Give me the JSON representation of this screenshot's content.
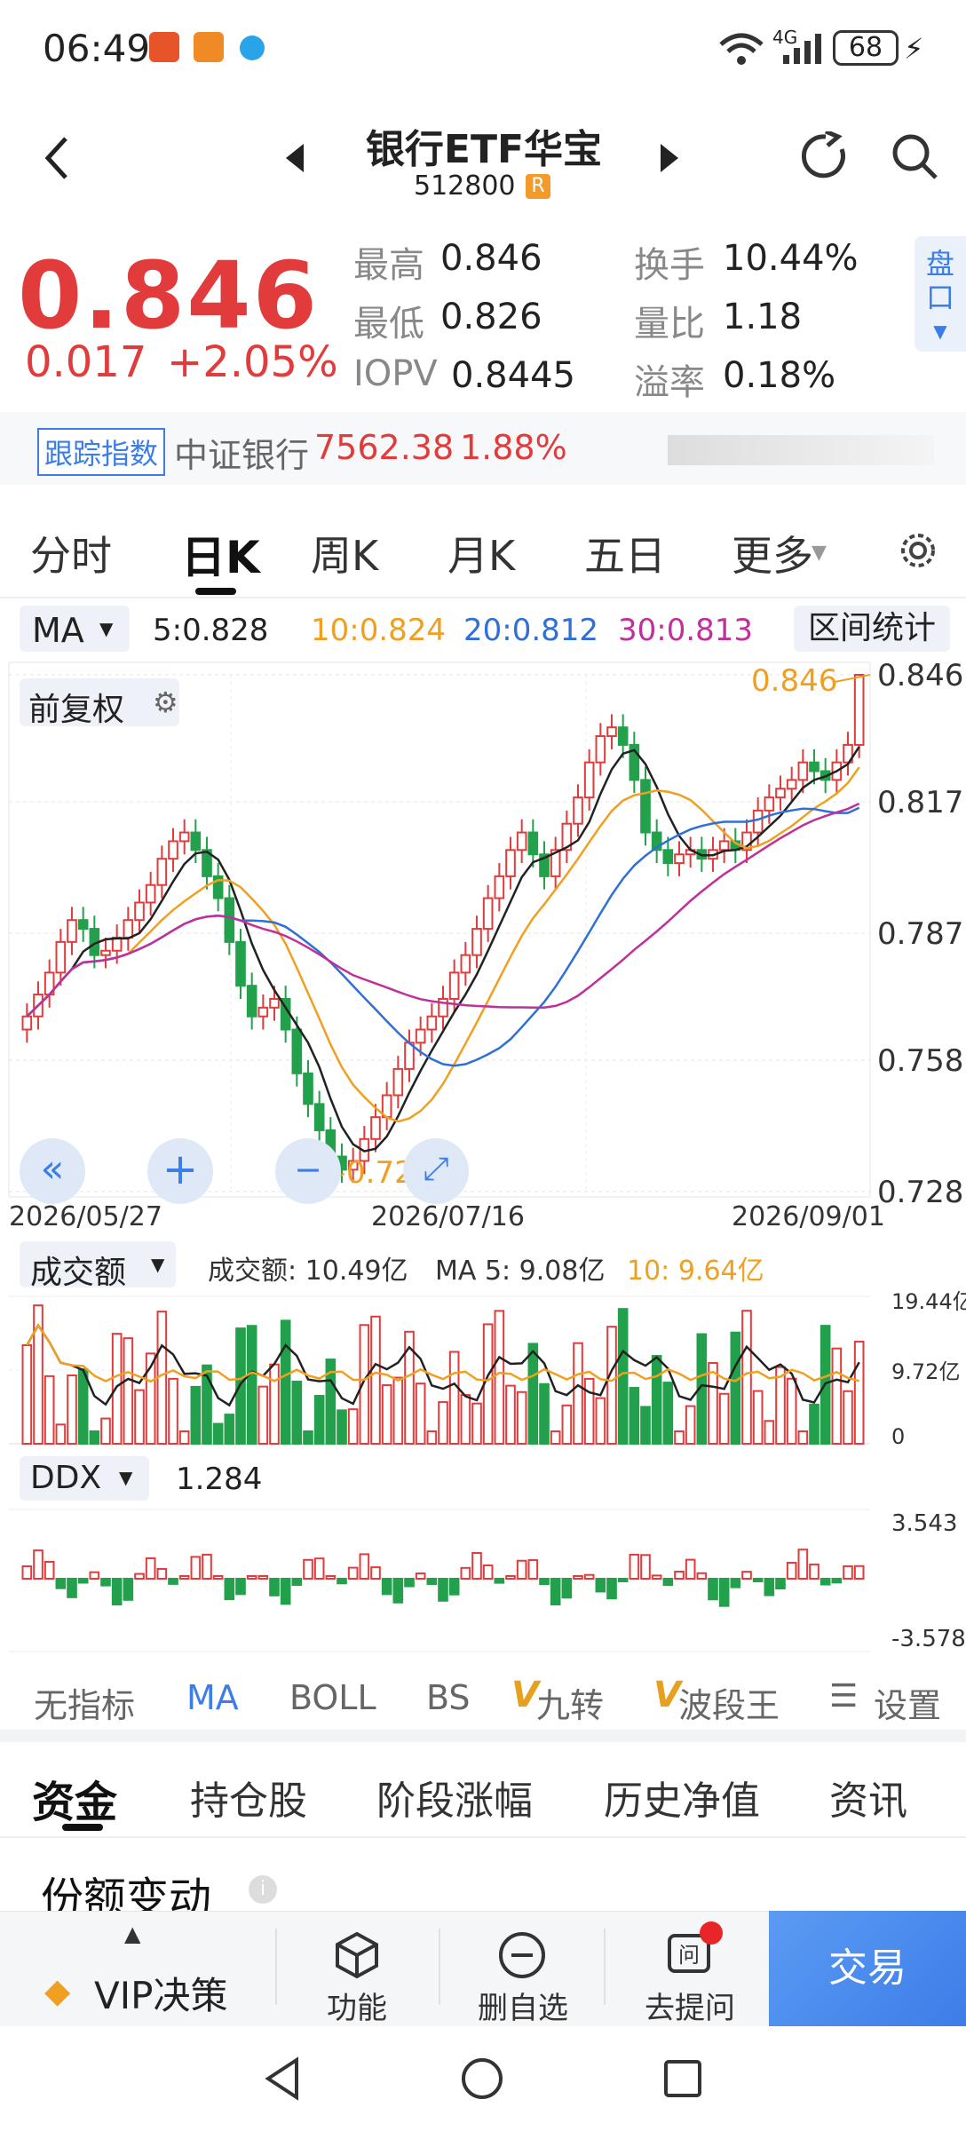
{
  "status_bar": {
    "time": "06:49",
    "network": "4G",
    "battery": "68"
  },
  "header": {
    "title": "银行ETF华宝",
    "code": "512800",
    "code_badge": "R"
  },
  "quote": {
    "price": "0.846",
    "change": "0.017",
    "change_pct": "+2.05%",
    "high_label": "最高",
    "high": "0.846",
    "low_label": "最低",
    "low": "0.826",
    "iopv_label": "IOPV",
    "iopv": "0.8445",
    "turnover_label": "换手",
    "turnover": "10.44%",
    "vol_ratio_label": "量比",
    "vol_ratio": "1.18",
    "premium_label": "溢率",
    "premium": "0.18%",
    "pankou": "盘口"
  },
  "tracking": {
    "tag": "跟踪指数",
    "index_name": "中证银行",
    "index_value": "7562.38",
    "index_pct": "1.88%"
  },
  "period_tabs": [
    "分时",
    "日K",
    "周K",
    "月K",
    "五日",
    "更多"
  ],
  "active_tab": "日K",
  "ma_bar": {
    "label": "MA",
    "ma5": "5:0.828",
    "ma10": "10:0.824",
    "ma20": "20:0.812",
    "ma30": "30:0.813",
    "stats_button": "区间统计"
  },
  "kchart": {
    "adjust_label": "前复权",
    "max_label": "0.846",
    "min_label": "0.728",
    "y_ticks": [
      "0.846",
      "0.817",
      "0.787",
      "0.758",
      "0.728"
    ],
    "dates": [
      "2026/05/27",
      "2026/07/16",
      "2026/09/01"
    ]
  },
  "volume": {
    "label": "成交额",
    "value_text": "成交额: 10.49亿",
    "ma5_text": "MA 5: 9.08亿",
    "ma10_text": "10: 9.64亿",
    "y_ticks": [
      "19.44亿",
      "9.72亿",
      "0"
    ]
  },
  "ddx": {
    "label": "DDX",
    "value": "1.284",
    "y_ticks": [
      "3.543",
      "-3.578"
    ]
  },
  "indicator_tabs": [
    "无指标",
    "MA",
    "BOLL",
    "BS",
    "九转",
    "波段王",
    "设置"
  ],
  "section_tabs": [
    "资金",
    "持仓股",
    "阶段涨幅",
    "历史净值",
    "资讯"
  ],
  "section_title": "份额变动",
  "bottom_nav": {
    "vip": "VIP决策",
    "func": "功能",
    "remove": "删自选",
    "ask": "去提问",
    "trade": "交易"
  },
  "colors": {
    "up": "#e23b3b",
    "down": "#22a04b",
    "ma5": "#222222",
    "ma10": "#f0a020",
    "ma20": "#2f6fd6",
    "ma30": "#c0309a",
    "accent": "#3d7de8"
  },
  "chart_data": {
    "type": "candlestick",
    "y_range": [
      0.728,
      0.846
    ],
    "dates": [
      "2026/05/27",
      "2026/07/16",
      "2026/09/01"
    ],
    "close_series": [
      0.768,
      0.773,
      0.778,
      0.785,
      0.79,
      0.788,
      0.782,
      0.783,
      0.786,
      0.79,
      0.794,
      0.798,
      0.804,
      0.808,
      0.81,
      0.806,
      0.8,
      0.795,
      0.785,
      0.775,
      0.768,
      0.77,
      0.772,
      0.765,
      0.755,
      0.748,
      0.742,
      0.736,
      0.733,
      0.735,
      0.74,
      0.745,
      0.75,
      0.756,
      0.762,
      0.765,
      0.768,
      0.772,
      0.778,
      0.782,
      0.788,
      0.795,
      0.8,
      0.806,
      0.81,
      0.805,
      0.8,
      0.806,
      0.812,
      0.818,
      0.826,
      0.832,
      0.834,
      0.83,
      0.822,
      0.81,
      0.806,
      0.803,
      0.805,
      0.806,
      0.804,
      0.806,
      0.808,
      0.806,
      0.81,
      0.815,
      0.818,
      0.82,
      0.822,
      0.826,
      0.824,
      0.822,
      0.826,
      0.83,
      0.846
    ],
    "volume": {
      "ma5": "9.08亿",
      "ma10": "9.64亿",
      "last": "10.49亿"
    },
    "ddx_last": 1.284
  }
}
